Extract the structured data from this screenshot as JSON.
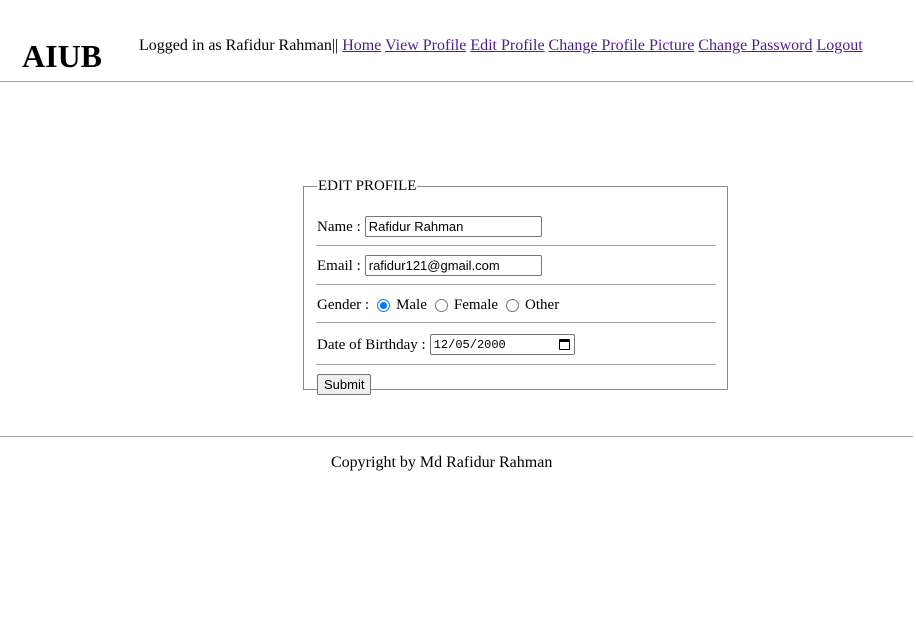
{
  "header": {
    "brand": "AIUB",
    "logged_in_text": "Logged in as Rafidur Rahman||",
    "nav": [
      {
        "label": "Home"
      },
      {
        "label": "View Profile"
      },
      {
        "label": "Edit Profile"
      },
      {
        "label": "Change Profile Picture"
      },
      {
        "label": "Change Password"
      },
      {
        "label": "Logout"
      }
    ]
  },
  "form": {
    "legend": "EDIT PROFILE",
    "name_label": "Name :",
    "name_value": "Rafidur Rahman",
    "email_label": "Email :",
    "email_value": "rafidur121@gmail.com",
    "gender_label": "Gender :",
    "gender_options": [
      {
        "label": "Male",
        "checked": true
      },
      {
        "label": "Female",
        "checked": false
      },
      {
        "label": "Other",
        "checked": false
      }
    ],
    "dob_label": "Date of Birthday :",
    "dob_value": "12/05/2000",
    "submit_label": "Submit"
  },
  "footer": {
    "text": "Copyright by Md Rafidur Rahman"
  },
  "colors": {
    "link": "#551a8b",
    "radio_checked": "#0075ff"
  }
}
